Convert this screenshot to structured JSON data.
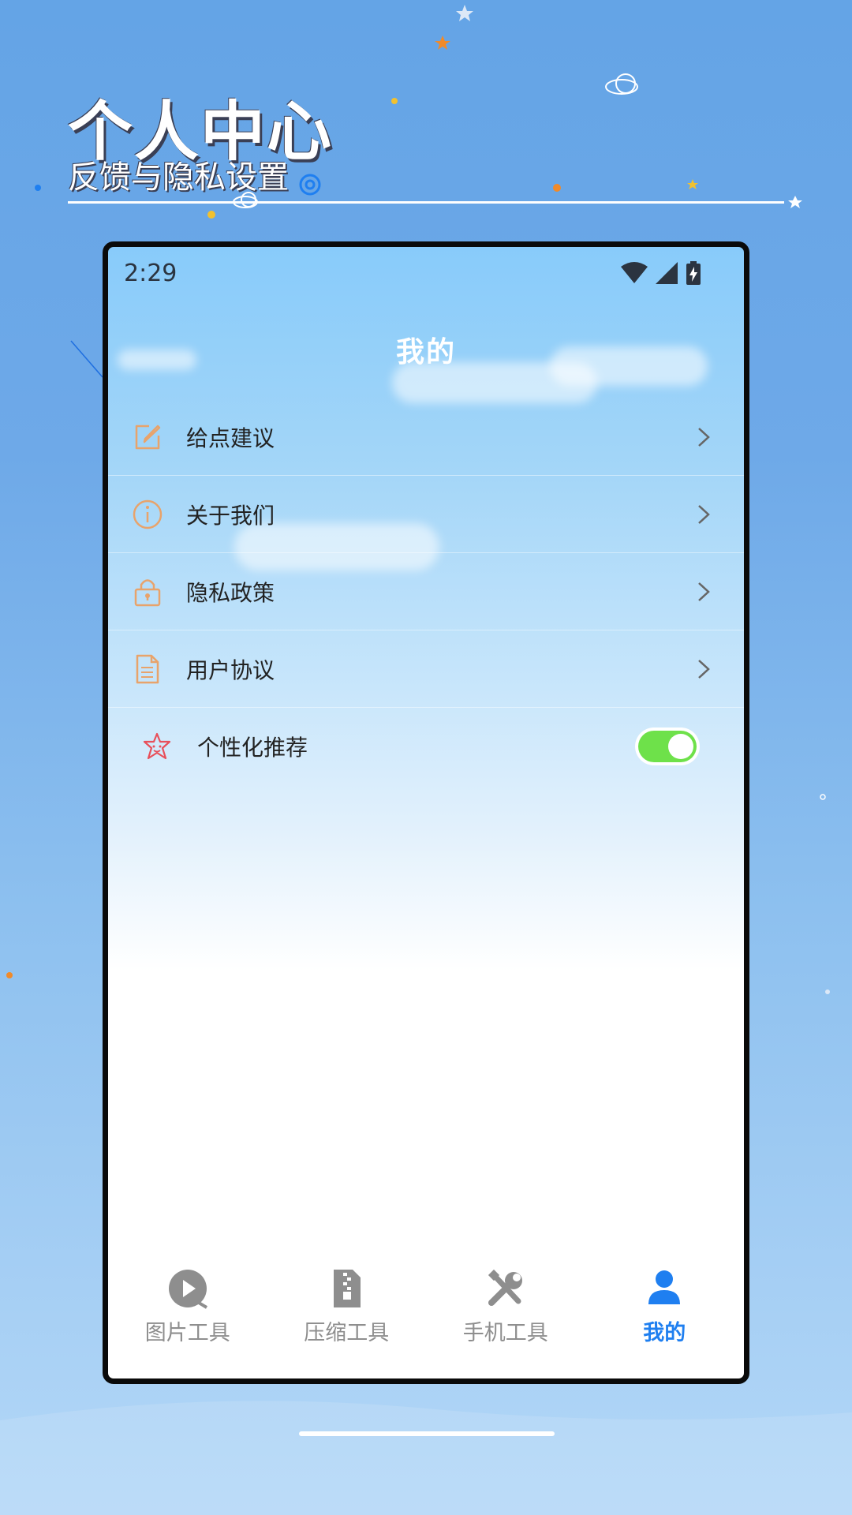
{
  "hero": {
    "title": "个人中心",
    "subtitle": "反馈与隐私设置"
  },
  "status_bar": {
    "time": "2:29",
    "icons": [
      "wifi-icon",
      "signal-icon",
      "battery-charging-icon"
    ]
  },
  "page_title": "我的",
  "menu": {
    "items": [
      {
        "label": "给点建议",
        "icon": "edit-icon"
      },
      {
        "label": "关于我们",
        "icon": "info-icon"
      },
      {
        "label": "隐私政策",
        "icon": "lock-icon"
      },
      {
        "label": "用户协议",
        "icon": "document-icon"
      },
      {
        "label": "个性化推荐",
        "icon": "star-face-icon",
        "toggle_on": true
      }
    ]
  },
  "tabbar": {
    "tabs": [
      {
        "label": "图片工具",
        "icon": "play-circle-icon",
        "active": false
      },
      {
        "label": "压缩工具",
        "icon": "zip-file-icon",
        "active": false
      },
      {
        "label": "手机工具",
        "icon": "tools-icon",
        "active": false
      },
      {
        "label": "我的",
        "icon": "user-icon",
        "active": true
      }
    ]
  },
  "colors": {
    "accent": "#1f7ff0",
    "icon_orange": "#e8a36b",
    "toggle_on": "#6ee14a",
    "tab_inactive": "#8e8e8e"
  }
}
